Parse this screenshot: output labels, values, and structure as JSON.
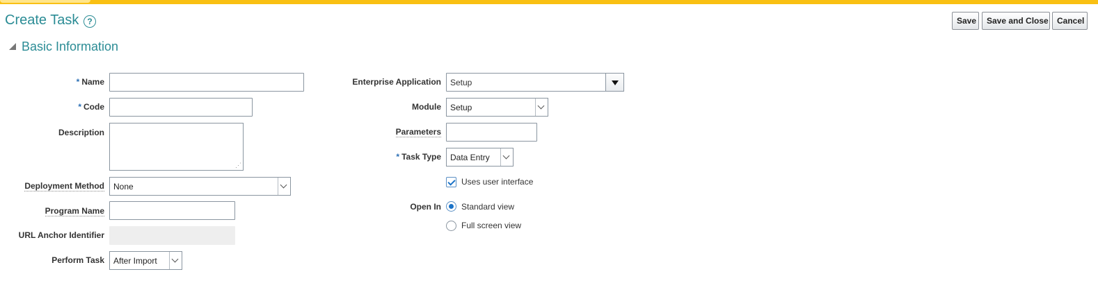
{
  "page": {
    "title": "Create Task",
    "help_icon": "help-circle-icon",
    "brand_color": "#f9c013",
    "accent_color": "#2b8c95"
  },
  "toolbar": {
    "save_label": "Save",
    "save_close_label": "Save and Close",
    "cancel_label": "Cancel"
  },
  "section": {
    "title": "Basic Information",
    "toggle_icon": "collapse-triangle-icon"
  },
  "form": {
    "name": {
      "label": "Name",
      "required": "*",
      "value": ""
    },
    "code": {
      "label": "Code",
      "required": "*",
      "value": ""
    },
    "description": {
      "label": "Description",
      "value": ""
    },
    "deployment_method": {
      "label": "Deployment Method",
      "value": "None"
    },
    "program_name": {
      "label": "Program Name",
      "value": ""
    },
    "url_anchor": {
      "label": "URL Anchor Identifier",
      "value": ""
    },
    "perform_task": {
      "label": "Perform Task",
      "value": "After Import"
    },
    "enterprise_application": {
      "label": "Enterprise Application",
      "value": "Setup"
    },
    "module": {
      "label": "Module",
      "value": "Setup"
    },
    "parameters": {
      "label": "Parameters",
      "value": ""
    },
    "task_type": {
      "label": "Task Type",
      "required": "*",
      "value": "Data Entry"
    },
    "uses_ui": {
      "label": "Uses user interface",
      "checked": true
    },
    "open_in": {
      "label": "Open In",
      "options": [
        "Standard view",
        "Full screen view"
      ],
      "selected": "Standard view"
    }
  }
}
